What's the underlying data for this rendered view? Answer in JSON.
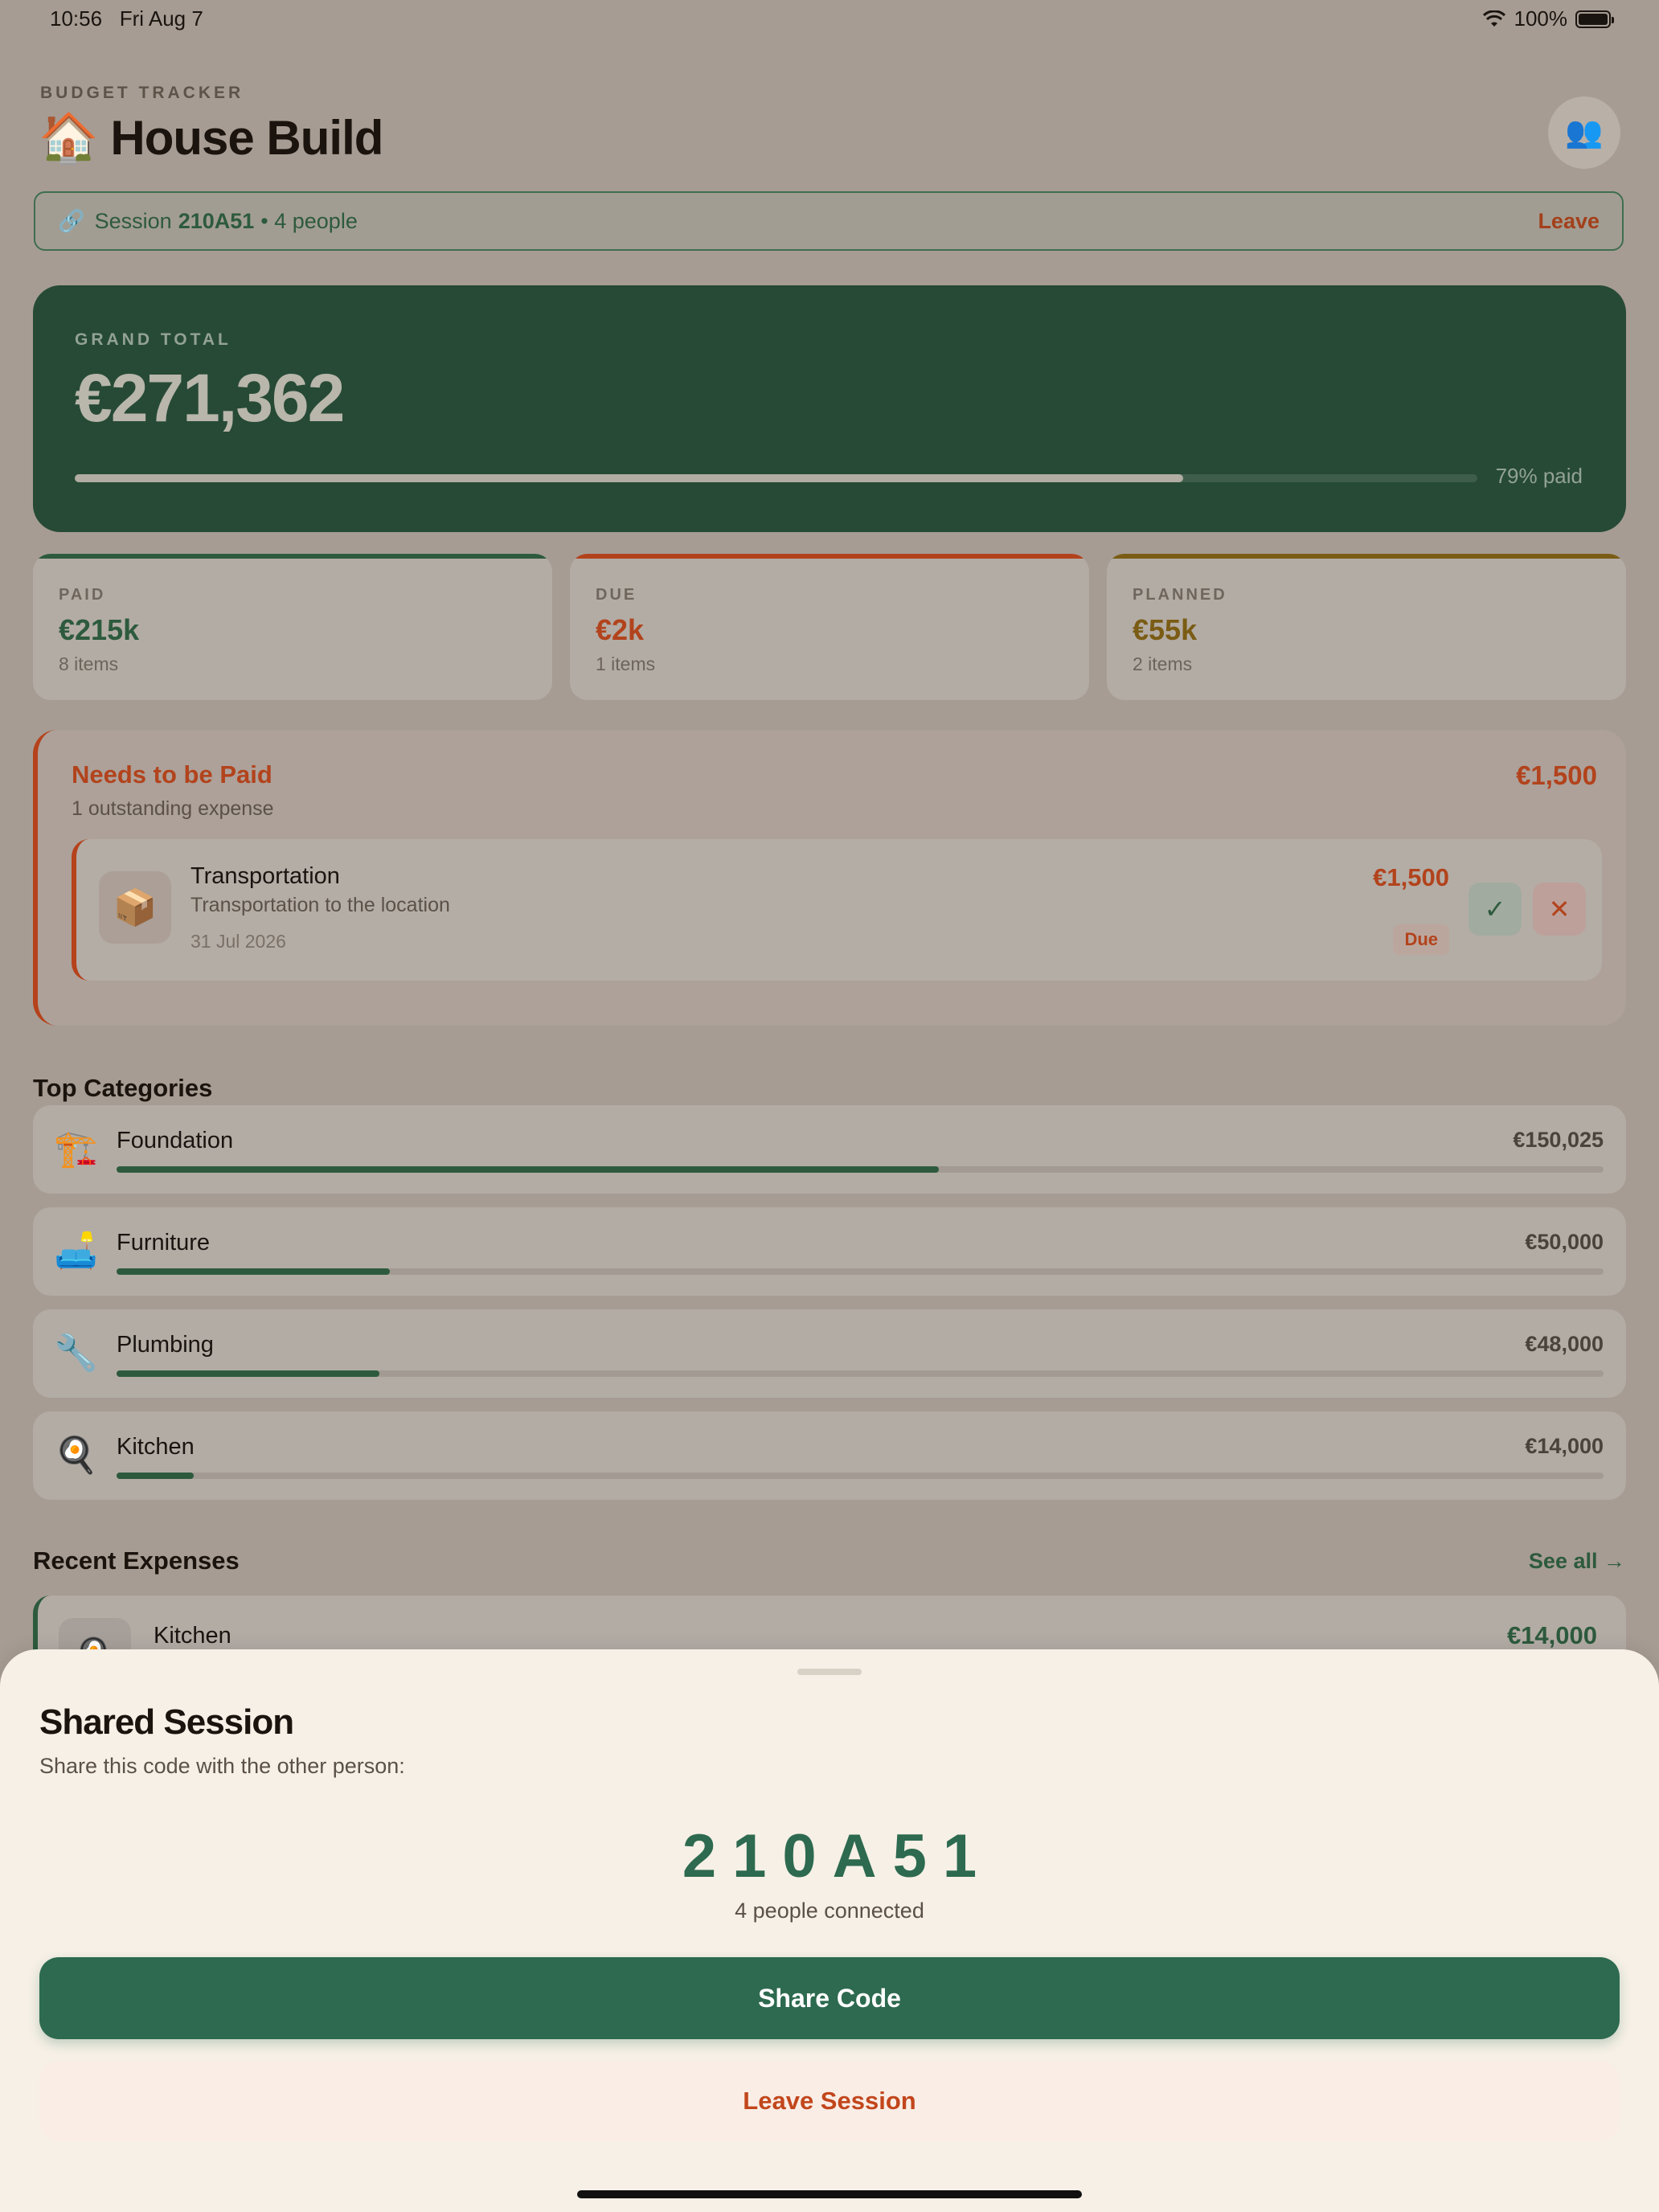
{
  "status": {
    "time": "10:56",
    "date": "Fri Aug 7",
    "battery": "100%"
  },
  "header": {
    "eyebrow": "BUDGET TRACKER",
    "title": "🏠 House Build",
    "people_icon": "👥"
  },
  "session_bar": {
    "link_icon": "🔗",
    "prefix": "Session",
    "code": "210A51",
    "people": "• 4 people",
    "leave": "Leave"
  },
  "grand_total": {
    "label": "GRAND TOTAL",
    "value": "€271,362",
    "paid_fraction": 0.79,
    "paid_label": "79% paid"
  },
  "stats": [
    {
      "label": "PAID",
      "value": "€215k",
      "sub": "8 items",
      "color": "#2d5a3d"
    },
    {
      "label": "DUE",
      "value": "€2k",
      "sub": "1 items",
      "color": "#b2431c"
    },
    {
      "label": "PLANNED",
      "value": "€55k",
      "sub": "2 items",
      "color": "#7a5c14"
    }
  ],
  "needs": {
    "title": "Needs to be Paid",
    "subtitle": "1 outstanding expense",
    "total": "€1,500",
    "expense": {
      "icon": "📦",
      "name": "Transportation",
      "description": "Transportation to the location",
      "date": "31 Jul 2026",
      "amount": "€1,500",
      "status": "Due",
      "confirm_icon": "✓",
      "reject_icon": "✕"
    }
  },
  "categories": {
    "title": "Top Categories",
    "items": [
      {
        "icon": "🏗️",
        "name": "Foundation",
        "amount": "€150,025",
        "fraction": 0.553
      },
      {
        "icon": "🛋️",
        "name": "Furniture",
        "amount": "€50,000",
        "fraction": 0.184
      },
      {
        "icon": "🔧",
        "name": "Plumbing",
        "amount": "€48,000",
        "fraction": 0.177
      },
      {
        "icon": "🍳",
        "name": "Kitchen",
        "amount": "€14,000",
        "fraction": 0.052
      }
    ]
  },
  "recent": {
    "title": "Recent Expenses",
    "see_all": "See all →",
    "first": {
      "icon": "🍳",
      "name": "Kitchen",
      "amount": "€14,000"
    }
  },
  "sheet": {
    "title": "Shared Session",
    "subtitle": "Share this code with the other person:",
    "code": "210A51",
    "connected": "4 people connected",
    "share_button": "Share Code",
    "leave_button": "Leave Session"
  }
}
